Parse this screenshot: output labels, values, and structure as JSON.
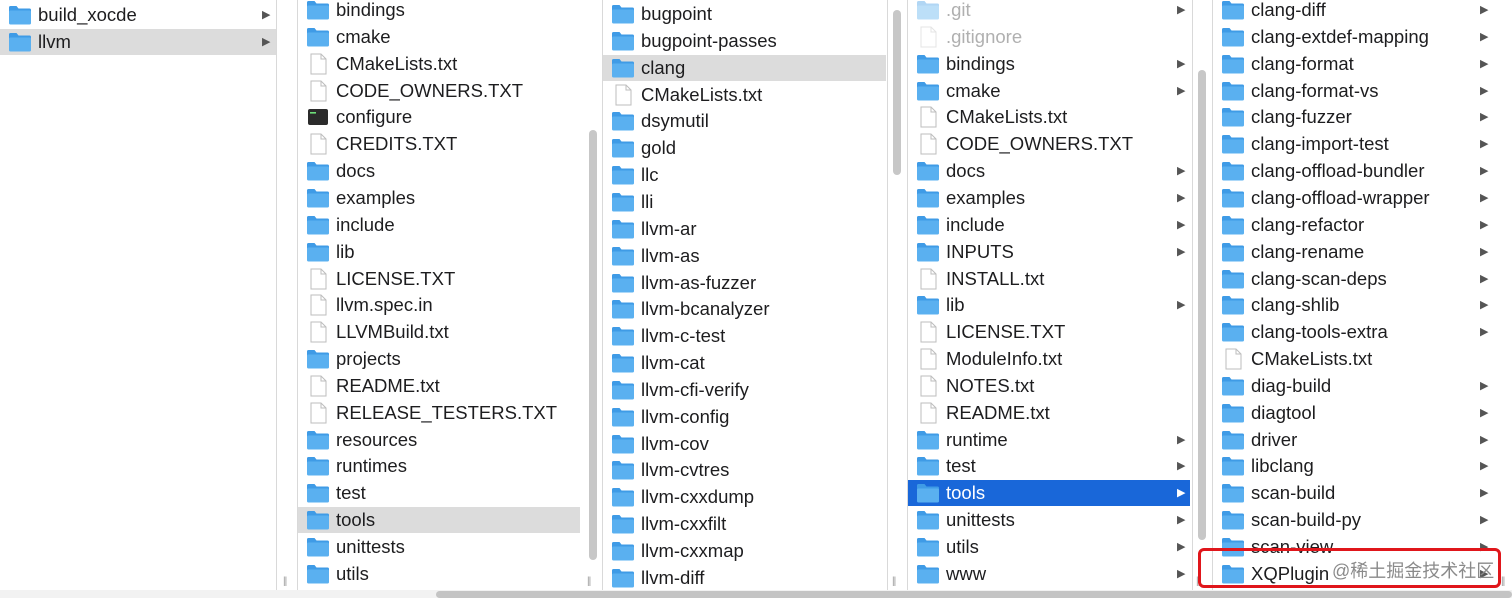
{
  "columns": [
    {
      "id": "c1",
      "items": [
        {
          "label": "build_xocde",
          "kind": "folder",
          "arrow": true
        },
        {
          "label": "llvm",
          "kind": "folder",
          "arrow": true,
          "state": "gray"
        }
      ]
    },
    {
      "id": "c2",
      "items": [
        {
          "label": "bindings",
          "kind": "folder",
          "arrow": true
        },
        {
          "label": "cmake",
          "kind": "folder",
          "arrow": true
        },
        {
          "label": "CMakeLists.txt",
          "kind": "file"
        },
        {
          "label": "CODE_OWNERS.TXT",
          "kind": "file"
        },
        {
          "label": "configure",
          "kind": "exec"
        },
        {
          "label": "CREDITS.TXT",
          "kind": "file"
        },
        {
          "label": "docs",
          "kind": "folder",
          "arrow": true
        },
        {
          "label": "examples",
          "kind": "folder",
          "arrow": true
        },
        {
          "label": "include",
          "kind": "folder",
          "arrow": true
        },
        {
          "label": "lib",
          "kind": "folder",
          "arrow": true
        },
        {
          "label": "LICENSE.TXT",
          "kind": "file"
        },
        {
          "label": "llvm.spec.in",
          "kind": "file"
        },
        {
          "label": "LLVMBuild.txt",
          "kind": "file"
        },
        {
          "label": "projects",
          "kind": "folder",
          "arrow": true
        },
        {
          "label": "README.txt",
          "kind": "file"
        },
        {
          "label": "RELEASE_TESTERS.TXT",
          "kind": "file"
        },
        {
          "label": "resources",
          "kind": "folder",
          "arrow": true
        },
        {
          "label": "runtimes",
          "kind": "folder",
          "arrow": true
        },
        {
          "label": "test",
          "kind": "folder",
          "arrow": true
        },
        {
          "label": "tools",
          "kind": "folder",
          "arrow": true,
          "state": "gray"
        },
        {
          "label": "unittests",
          "kind": "folder",
          "arrow": true
        },
        {
          "label": "utils",
          "kind": "folder",
          "arrow": true
        }
      ]
    },
    {
      "id": "c3",
      "items": [
        {
          "label": "bugpoint",
          "kind": "folder",
          "arrow": true
        },
        {
          "label": "bugpoint-passes",
          "kind": "folder",
          "arrow": true
        },
        {
          "label": "clang",
          "kind": "folder",
          "arrow": true,
          "state": "gray"
        },
        {
          "label": "CMakeLists.txt",
          "kind": "file"
        },
        {
          "label": "dsymutil",
          "kind": "folder",
          "arrow": true
        },
        {
          "label": "gold",
          "kind": "folder",
          "arrow": true
        },
        {
          "label": "llc",
          "kind": "folder",
          "arrow": true
        },
        {
          "label": "lli",
          "kind": "folder",
          "arrow": true
        },
        {
          "label": "llvm-ar",
          "kind": "folder",
          "arrow": true
        },
        {
          "label": "llvm-as",
          "kind": "folder",
          "arrow": true
        },
        {
          "label": "llvm-as-fuzzer",
          "kind": "folder",
          "arrow": true
        },
        {
          "label": "llvm-bcanalyzer",
          "kind": "folder",
          "arrow": true
        },
        {
          "label": "llvm-c-test",
          "kind": "folder",
          "arrow": true
        },
        {
          "label": "llvm-cat",
          "kind": "folder",
          "arrow": true
        },
        {
          "label": "llvm-cfi-verify",
          "kind": "folder",
          "arrow": true
        },
        {
          "label": "llvm-config",
          "kind": "folder",
          "arrow": true
        },
        {
          "label": "llvm-cov",
          "kind": "folder",
          "arrow": true
        },
        {
          "label": "llvm-cvtres",
          "kind": "folder",
          "arrow": true
        },
        {
          "label": "llvm-cxxdump",
          "kind": "folder",
          "arrow": true
        },
        {
          "label": "llvm-cxxfilt",
          "kind": "folder",
          "arrow": true
        },
        {
          "label": "llvm-cxxmap",
          "kind": "folder",
          "arrow": true
        },
        {
          "label": "llvm-diff",
          "kind": "folder",
          "arrow": true
        }
      ]
    },
    {
      "id": "c4",
      "items": [
        {
          "label": ".git",
          "kind": "folder",
          "arrow": true,
          "faded": true
        },
        {
          "label": ".gitignore",
          "kind": "file",
          "faded": true
        },
        {
          "label": "bindings",
          "kind": "folder",
          "arrow": true
        },
        {
          "label": "cmake",
          "kind": "folder",
          "arrow": true
        },
        {
          "label": "CMakeLists.txt",
          "kind": "file"
        },
        {
          "label": "CODE_OWNERS.TXT",
          "kind": "file"
        },
        {
          "label": "docs",
          "kind": "folder",
          "arrow": true
        },
        {
          "label": "examples",
          "kind": "folder",
          "arrow": true
        },
        {
          "label": "include",
          "kind": "folder",
          "arrow": true
        },
        {
          "label": "INPUTS",
          "kind": "folder",
          "arrow": true
        },
        {
          "label": "INSTALL.txt",
          "kind": "file"
        },
        {
          "label": "lib",
          "kind": "folder",
          "arrow": true
        },
        {
          "label": "LICENSE.TXT",
          "kind": "file"
        },
        {
          "label": "ModuleInfo.txt",
          "kind": "file"
        },
        {
          "label": "NOTES.txt",
          "kind": "file"
        },
        {
          "label": "README.txt",
          "kind": "file"
        },
        {
          "label": "runtime",
          "kind": "folder",
          "arrow": true
        },
        {
          "label": "test",
          "kind": "folder",
          "arrow": true
        },
        {
          "label": "tools",
          "kind": "folder",
          "arrow": true,
          "state": "blue"
        },
        {
          "label": "unittests",
          "kind": "folder",
          "arrow": true
        },
        {
          "label": "utils",
          "kind": "folder",
          "arrow": true
        },
        {
          "label": "www",
          "kind": "folder",
          "arrow": true
        }
      ]
    },
    {
      "id": "c5",
      "items": [
        {
          "label": "clang-diff",
          "kind": "folder",
          "arrow": true
        },
        {
          "label": "clang-extdef-mapping",
          "kind": "folder",
          "arrow": true
        },
        {
          "label": "clang-format",
          "kind": "folder",
          "arrow": true
        },
        {
          "label": "clang-format-vs",
          "kind": "folder",
          "arrow": true
        },
        {
          "label": "clang-fuzzer",
          "kind": "folder",
          "arrow": true
        },
        {
          "label": "clang-import-test",
          "kind": "folder",
          "arrow": true
        },
        {
          "label": "clang-offload-bundler",
          "kind": "folder",
          "arrow": true
        },
        {
          "label": "clang-offload-wrapper",
          "kind": "folder",
          "arrow": true
        },
        {
          "label": "clang-refactor",
          "kind": "folder",
          "arrow": true
        },
        {
          "label": "clang-rename",
          "kind": "folder",
          "arrow": true
        },
        {
          "label": "clang-scan-deps",
          "kind": "folder",
          "arrow": true
        },
        {
          "label": "clang-shlib",
          "kind": "folder",
          "arrow": true
        },
        {
          "label": "clang-tools-extra",
          "kind": "folder",
          "arrow": true
        },
        {
          "label": "CMakeLists.txt",
          "kind": "file"
        },
        {
          "label": "diag-build",
          "kind": "folder",
          "arrow": true
        },
        {
          "label": "diagtool",
          "kind": "folder",
          "arrow": true
        },
        {
          "label": "driver",
          "kind": "folder",
          "arrow": true
        },
        {
          "label": "libclang",
          "kind": "folder",
          "arrow": true
        },
        {
          "label": "scan-build",
          "kind": "folder",
          "arrow": true
        },
        {
          "label": "scan-build-py",
          "kind": "folder",
          "arrow": true
        },
        {
          "label": "scan-view",
          "kind": "folder",
          "arrow": true
        },
        {
          "label": "XQPlugin",
          "kind": "folder",
          "arrow": true
        }
      ]
    }
  ],
  "watermark": "@稀土掘金技术社区",
  "colors": {
    "folder": "#5ab0f0",
    "folder_tab": "#3f9be6",
    "selection_blue": "#1967d9",
    "selection_gray": "#dcdcdc",
    "highlight": "#e0161b"
  }
}
